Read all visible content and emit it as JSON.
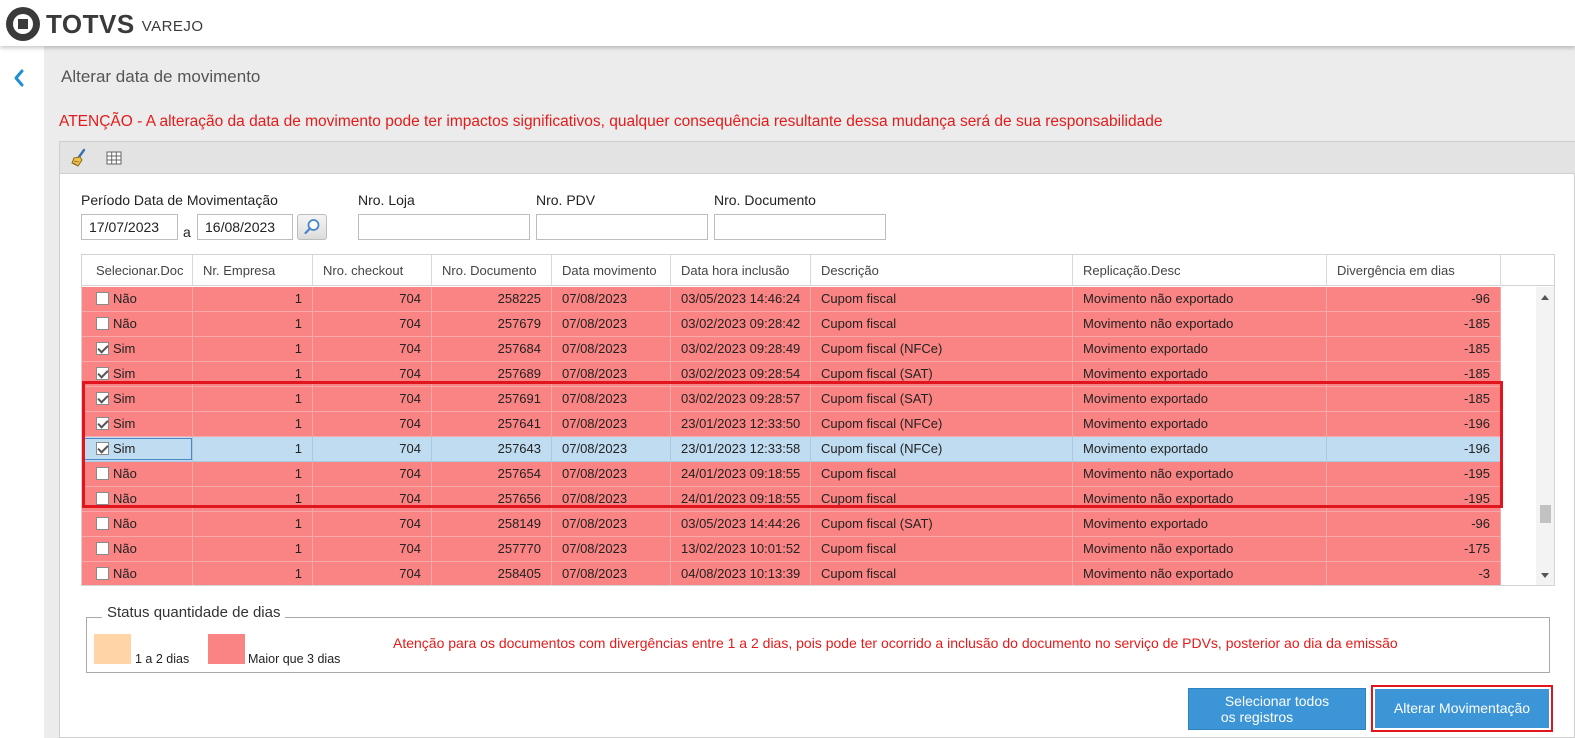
{
  "app": {
    "brand": "TOTVS",
    "brand_sub": "VAREJO"
  },
  "page": {
    "title": "Alterar data de movimento",
    "warning": "ATENÇÃO - A alteração da data de movimento pode ter impactos significativos, qualquer consequência resultante dessa mudança será de sua responsabilidade"
  },
  "toolbar": {
    "icons": [
      "broom-icon",
      "grid-icon"
    ]
  },
  "filters": {
    "periodo_label": "Período Data de Movimentação",
    "date_from": "17/07/2023",
    "date_sep": "a",
    "date_to": "16/08/2023",
    "loja_label": "Nro. Loja",
    "loja_value": "",
    "pdv_label": "Nro. PDV",
    "pdv_value": "",
    "documento_label": "Nro. Documento",
    "documento_value": ""
  },
  "table": {
    "columns": [
      "Selecionar.Doc",
      "Nr. Empresa",
      "Nro. checkout",
      "Nro. Documento",
      "Data movimento",
      "Data hora inclusão",
      "Descrição",
      "Replicação.Desc",
      "Divergência em dias"
    ],
    "rows": [
      {
        "checked": false,
        "sel": "Não",
        "empresa": "1",
        "checkout": "704",
        "documento": "258225",
        "data_mov": "07/08/2023",
        "data_inc": "03/05/2023 14:46:24",
        "descricao": "Cupom fiscal",
        "replicacao": "Movimento não exportado",
        "divergencia": "-96"
      },
      {
        "checked": false,
        "sel": "Não",
        "empresa": "1",
        "checkout": "704",
        "documento": "257679",
        "data_mov": "07/08/2023",
        "data_inc": "03/02/2023 09:28:42",
        "descricao": "Cupom fiscal",
        "replicacao": "Movimento não exportado",
        "divergencia": "-185"
      },
      {
        "checked": true,
        "sel": "Sim",
        "empresa": "1",
        "checkout": "704",
        "documento": "257684",
        "data_mov": "07/08/2023",
        "data_inc": "03/02/2023 09:28:49",
        "descricao": "Cupom fiscal (NFCe)",
        "replicacao": "Movimento exportado",
        "divergencia": "-185"
      },
      {
        "checked": true,
        "sel": "Sim",
        "empresa": "1",
        "checkout": "704",
        "documento": "257689",
        "data_mov": "07/08/2023",
        "data_inc": "03/02/2023 09:28:54",
        "descricao": "Cupom fiscal (SAT)",
        "replicacao": "Movimento exportado",
        "divergencia": "-185"
      },
      {
        "checked": true,
        "sel": "Sim",
        "empresa": "1",
        "checkout": "704",
        "documento": "257691",
        "data_mov": "07/08/2023",
        "data_inc": "03/02/2023 09:28:57",
        "descricao": "Cupom fiscal (SAT)",
        "replicacao": "Movimento exportado",
        "divergencia": "-185"
      },
      {
        "checked": true,
        "sel": "Sim",
        "empresa": "1",
        "checkout": "704",
        "documento": "257641",
        "data_mov": "07/08/2023",
        "data_inc": "23/01/2023 12:33:50",
        "descricao": "Cupom fiscal (NFCe)",
        "replicacao": "Movimento exportado",
        "divergencia": "-196"
      },
      {
        "checked": true,
        "sel": "Sim",
        "empresa": "1",
        "checkout": "704",
        "documento": "257643",
        "data_mov": "07/08/2023",
        "data_inc": "23/01/2023 12:33:58",
        "descricao": "Cupom fiscal (NFCe)",
        "replicacao": "Movimento exportado",
        "divergencia": "-196",
        "selected": true
      },
      {
        "checked": false,
        "sel": "Não",
        "empresa": "1",
        "checkout": "704",
        "documento": "257654",
        "data_mov": "07/08/2023",
        "data_inc": "24/01/2023 09:18:55",
        "descricao": "Cupom fiscal",
        "replicacao": "Movimento não exportado",
        "divergencia": "-195"
      },
      {
        "checked": false,
        "sel": "Não",
        "empresa": "1",
        "checkout": "704",
        "documento": "257656",
        "data_mov": "07/08/2023",
        "data_inc": "24/01/2023 09:18:55",
        "descricao": "Cupom fiscal",
        "replicacao": "Movimento não exportado",
        "divergencia": "-195"
      },
      {
        "checked": false,
        "sel": "Não",
        "empresa": "1",
        "checkout": "704",
        "documento": "258149",
        "data_mov": "07/08/2023",
        "data_inc": "03/05/2023 14:44:26",
        "descricao": "Cupom fiscal (SAT)",
        "replicacao": "Movimento exportado",
        "divergencia": "-96"
      },
      {
        "checked": false,
        "sel": "Não",
        "empresa": "1",
        "checkout": "704",
        "documento": "257770",
        "data_mov": "07/08/2023",
        "data_inc": "13/02/2023 10:01:52",
        "descricao": "Cupom fiscal",
        "replicacao": "Movimento não exportado",
        "divergencia": "-175"
      },
      {
        "checked": false,
        "sel": "Não",
        "empresa": "1",
        "checkout": "704",
        "documento": "258405",
        "data_mov": "07/08/2023",
        "data_inc": "04/08/2023 10:13:39",
        "descricao": "Cupom fiscal",
        "replicacao": "Movimento não exportado",
        "divergencia": "-3"
      }
    ]
  },
  "status": {
    "legend": "Status quantidade de dias",
    "item1_label": "1 a 2 dias",
    "item1_color": "#ffd4a6",
    "item2_label": "Maior que 3 dias",
    "item2_color": "#fa8383",
    "note": "Atenção para os documentos com divergências entre 1 a 2 dias, pois pode ter ocorrido a inclusão do documento no serviço de PDVs, posterior ao dia da emissão"
  },
  "buttons": {
    "select_all_line1": "Selecionar todos",
    "select_all_line2": "os registros",
    "alterar": "Alterar Movimentação"
  }
}
